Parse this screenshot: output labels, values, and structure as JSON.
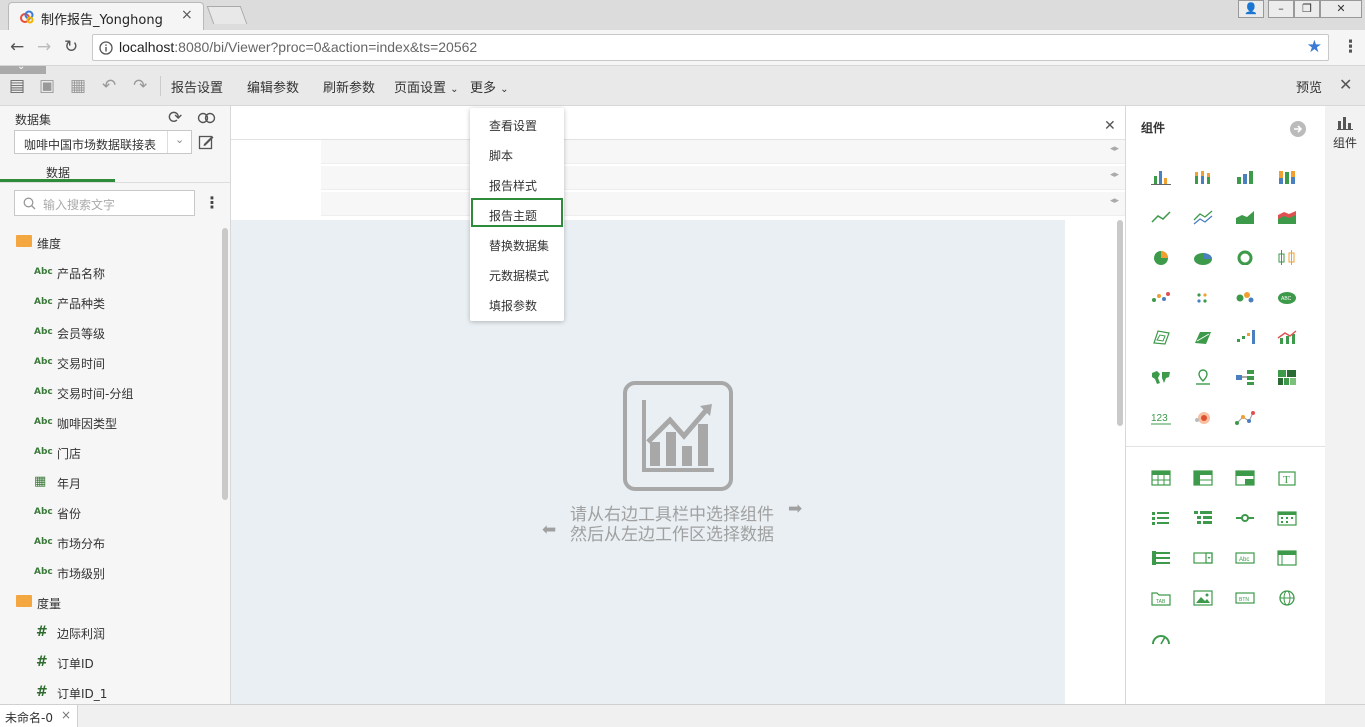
{
  "browser": {
    "tab_title": "制作报告_Yonghong",
    "tab_close": "×",
    "url_host": "localhost",
    "url_rest": ":8080/bi/Viewer?proc=0&action=index&ts=20562",
    "win_min": "–",
    "win_max": "❐",
    "win_close": "✕",
    "win_user": "👤"
  },
  "toolbar": {
    "menu_report_settings": "报告设置",
    "menu_edit_params": "编辑参数",
    "menu_refresh_params": "刷新参数",
    "menu_page_settings": "页面设置",
    "menu_more": "更多",
    "preview": "预览",
    "close": "✕"
  },
  "dropdown": {
    "items": [
      "查看设置",
      "脚本",
      "报告样式",
      "报告主题",
      "替换数据集",
      "元数据模式",
      "填报参数"
    ],
    "selected": "报告主题"
  },
  "left": {
    "dataset_label": "数据集",
    "dataset_value": "咖啡中国市场数据联接表",
    "tab_data": "数据",
    "search_placeholder": "输入搜索文字",
    "dimension_folder": "维度",
    "dimensions": [
      "产品名称",
      "产品种类",
      "会员等级",
      "交易时间",
      "交易时间-分组",
      "咖啡因类型",
      "门店",
      "年月",
      "省份",
      "市场分布",
      "市场级别"
    ],
    "measure_folder": "度量",
    "measures": [
      "边际利润",
      "订单ID",
      "订单ID_1"
    ],
    "abc": "Abc",
    "hash": "#"
  },
  "center": {
    "hint_line1": "请从右边工具栏中选择组件",
    "hint_line2": "然后从左边工作区选择数据",
    "close": "✕"
  },
  "right": {
    "title": "组件",
    "tab_label": "组件",
    "num_label": "123"
  },
  "status": {
    "sheet_name": "未命名-0",
    "sheet_close": "×"
  },
  "colors": {
    "accent_green": "#2e8b3a",
    "folder_orange": "#f4a640",
    "icon_green": "#3c9a4a",
    "icon_orange": "#f0a030",
    "icon_blue": "#4a7fc0"
  }
}
